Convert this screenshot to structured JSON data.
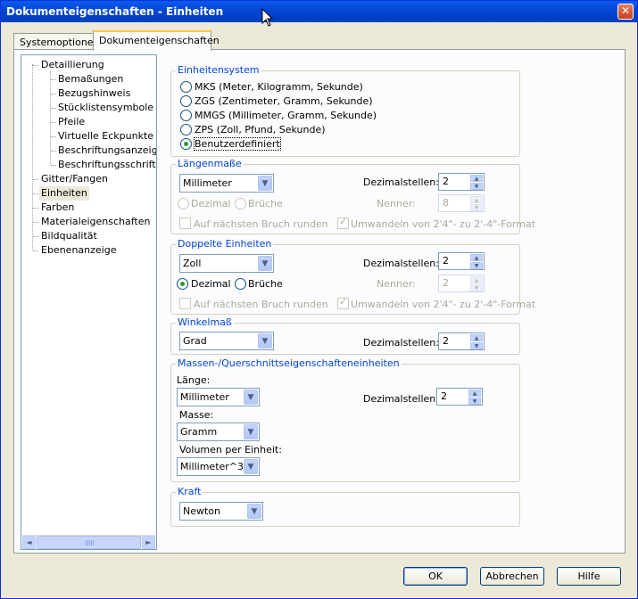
{
  "window": {
    "title": "Dokumenteigenschaften - Einheiten",
    "close_label": "✕"
  },
  "tabs": [
    {
      "label": "Systemoptionen"
    },
    {
      "label": "Dokumenteigenschaften"
    }
  ],
  "tree": {
    "items": [
      {
        "label": "Detaillierung"
      },
      {
        "label": "Bemaßungen"
      },
      {
        "label": "Bezugshinweis"
      },
      {
        "label": "Stücklistensymbole"
      },
      {
        "label": "Pfeile"
      },
      {
        "label": "Virtuelle Eckpunkte"
      },
      {
        "label": "Beschriftungsanzeige"
      },
      {
        "label": "Beschriftungsschriftart"
      },
      {
        "label": "Gitter/Fangen"
      },
      {
        "label": "Einheiten"
      },
      {
        "label": "Farben"
      },
      {
        "label": "Materialeigenschaften"
      },
      {
        "label": "Bildqualität"
      },
      {
        "label": "Ebenenanzeige"
      }
    ],
    "selected": "Einheiten"
  },
  "einheitensystem": {
    "title": "Einheitensystem",
    "options": [
      {
        "label": "MKS  (Meter, Kilogramm, Sekunde)"
      },
      {
        "label": "ZGS  (Zentimeter, Gramm, Sekunde)"
      },
      {
        "label": "MMGS (Millimeter, Gramm, Sekunde)"
      },
      {
        "label": "ZPS  (Zoll, Pfund, Sekunde)"
      },
      {
        "label": "Benutzerdefiniert"
      }
    ],
    "selected": "Benutzerdefiniert"
  },
  "laengenmasse": {
    "title": "Längenmaße",
    "unit": "Millimeter",
    "decimals_label": "Dezimalstellen:",
    "decimals": "2",
    "dezimal_label": "Dezimal",
    "brueche_label": "Brüche",
    "nenner_label": "Nenner:",
    "nenner": "8",
    "round_label": "Auf nächsten Bruch runden",
    "convert_label": "Umwandeln von 2'4\"- zu 2'-4\"-Format"
  },
  "doppelte": {
    "title": "Doppelte Einheiten",
    "unit": "Zoll",
    "decimals_label": "Dezimalstellen:",
    "decimals": "2",
    "dezimal_label": "Dezimal",
    "brueche_label": "Brüche",
    "nenner_label": "Nenner:",
    "nenner": "2",
    "round_label": "Auf nächsten Bruch runden",
    "convert_label": "Umwandeln von 2'4\"- zu 2'-4\"-Format"
  },
  "winkel": {
    "title": "Winkelmaß",
    "unit": "Grad",
    "decimals_label": "Dezimalstellen:",
    "decimals": "2"
  },
  "masse": {
    "title": "Massen-/Querschnittseigenschafteneinheiten",
    "length_label": "Länge:",
    "length": "Millimeter",
    "mass_label": "Masse:",
    "mass": "Gramm",
    "volume_label": "Volumen per Einheit:",
    "volume": "Millimeter^3",
    "decimals_label": "Dezimalstellen:",
    "decimals": "2"
  },
  "kraft": {
    "title": "Kraft",
    "unit": "Newton"
  },
  "buttons": {
    "ok": "OK",
    "cancel": "Abbrechen",
    "help": "Hilfe"
  },
  "icons": {
    "dropdown": "▼",
    "up": "▲",
    "down": "▼",
    "left": "◄",
    "right": "►",
    "check": "✓"
  }
}
